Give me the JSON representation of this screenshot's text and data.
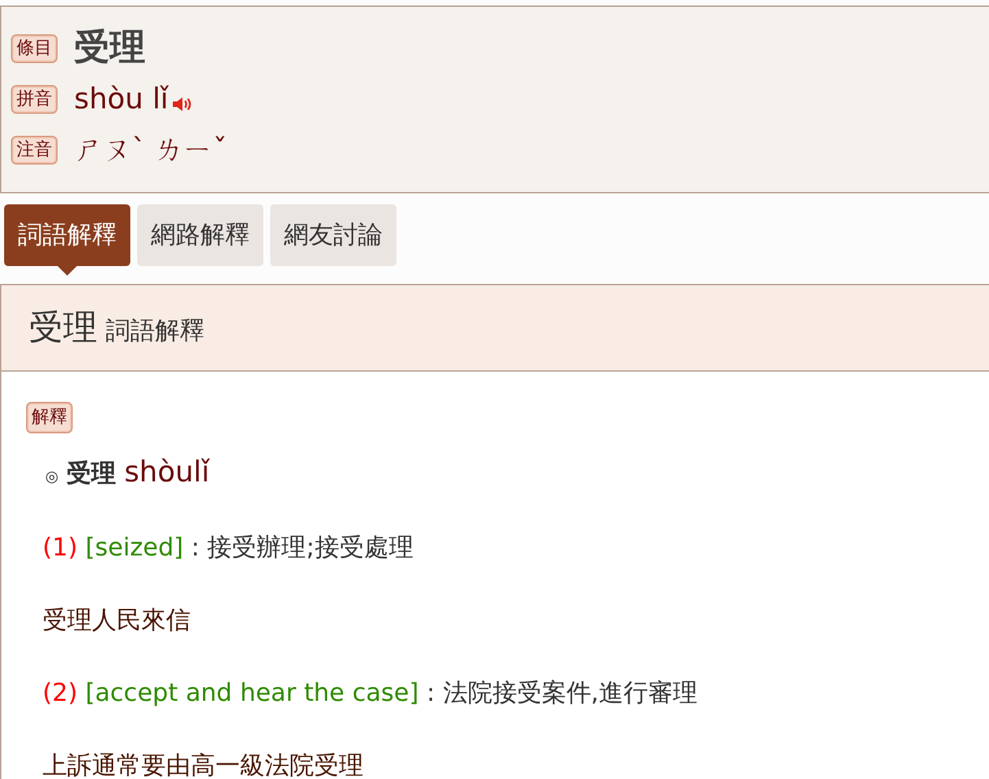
{
  "header": {
    "rows": [
      {
        "tag": "條目",
        "kind": "title",
        "text": "受理"
      },
      {
        "tag": "拼音",
        "kind": "pinyin",
        "text": "shòu lǐ"
      },
      {
        "tag": "注音",
        "kind": "zhuyin",
        "text": "ㄕㄡˋ ㄌㄧˇ"
      }
    ]
  },
  "tabs": [
    {
      "label": "詞語解釋",
      "selected": true
    },
    {
      "label": "網路解釋",
      "selected": false
    },
    {
      "label": "網友討論",
      "selected": false
    }
  ],
  "panel": {
    "title": "受理",
    "subtitle": "詞語解釋",
    "tag": "解釋",
    "headword": {
      "marker": "◎",
      "word": "受理",
      "pinyin": "shòulǐ"
    },
    "senses": [
      {
        "number": "(1)",
        "english": "[seized]",
        "definition": ": 接受辦理;接受處理",
        "example": "受理人民來信"
      },
      {
        "number": "(2)",
        "english": "[accept and hear the case]",
        "definition": ": 法院接受案件,進行審理",
        "example": "上訴通常要由高一級法院受理"
      }
    ]
  }
}
